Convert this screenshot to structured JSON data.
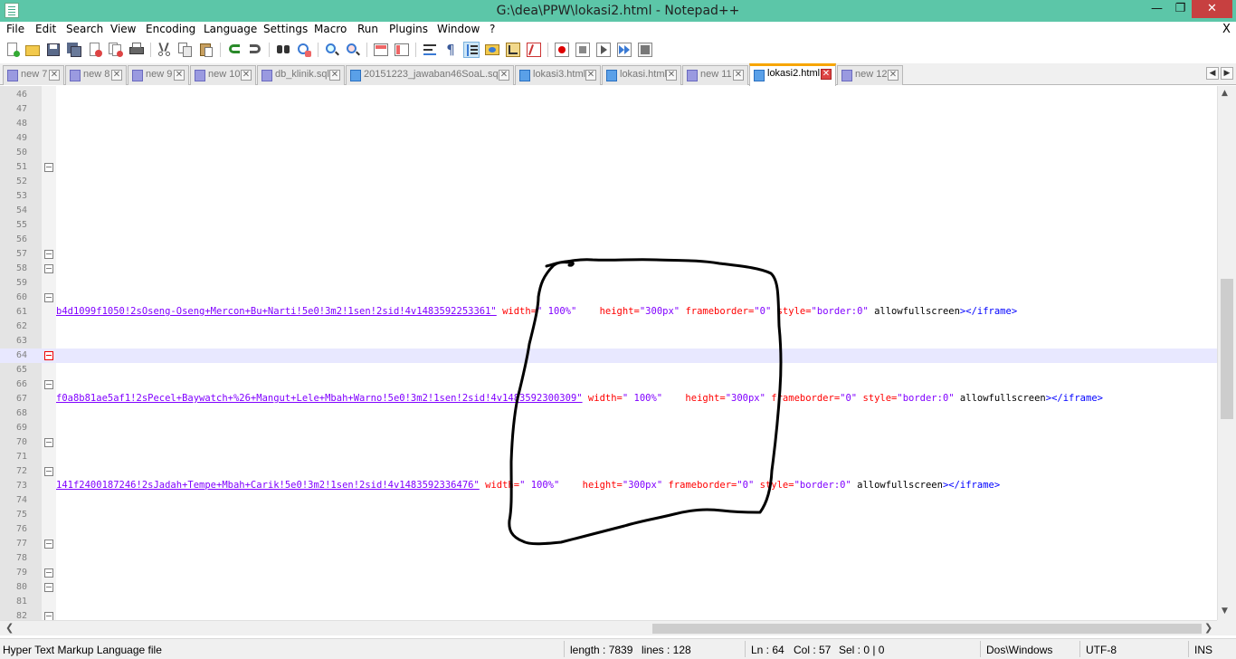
{
  "window": {
    "title": "G:\\dea\\PPW\\lokasi2.html - Notepad++",
    "min_label": "—",
    "max_label": "❐",
    "close_label": "✕"
  },
  "menu": {
    "items": [
      "File",
      "Edit",
      "Search",
      "View",
      "Encoding",
      "Language",
      "Settings",
      "Macro",
      "Run",
      "Plugins",
      "Window",
      "?"
    ],
    "close_doc": "X"
  },
  "toolbar": {
    "icons": [
      "new-file-icon",
      "open-file-icon",
      "save-icon",
      "save-all-icon",
      "close-icon",
      "close-all-icon",
      "print-icon",
      "cut-icon",
      "copy-icon",
      "paste-icon",
      "undo-icon",
      "redo-icon",
      "find-icon",
      "replace-icon",
      "zoom-in-icon",
      "zoom-out-icon",
      "sync-vertical-icon",
      "sync-horizontal-icon",
      "word-wrap-icon",
      "show-all-chars-icon",
      "indent-guide-icon",
      "user-language-icon",
      "doc-map-icon",
      "function-list-icon",
      "record-macro-icon",
      "stop-macro-icon",
      "play-macro-icon",
      "run-macro-multiple-icon",
      "save-macro-icon"
    ]
  },
  "tabs": [
    {
      "label": "new 7",
      "type": "text",
      "active": false
    },
    {
      "label": "new 8",
      "type": "text",
      "active": false
    },
    {
      "label": "new 9",
      "type": "text",
      "active": false
    },
    {
      "label": "new 10",
      "type": "text",
      "active": false
    },
    {
      "label": "db_klinik.sql",
      "type": "text",
      "active": false
    },
    {
      "label": "20151223_jawaban46SoaL.sql",
      "type": "html",
      "active": false
    },
    {
      "label": "lokasi3.html",
      "type": "html",
      "active": false
    },
    {
      "label": "lokasi.html",
      "type": "html",
      "active": false
    },
    {
      "label": "new 11",
      "type": "text",
      "active": false
    },
    {
      "label": "lokasi2.html",
      "type": "html",
      "active": true
    },
    {
      "label": "new 12",
      "type": "text",
      "active": false
    }
  ],
  "tab_close_label": "✕",
  "tab_nav": {
    "prev": "◀",
    "next": "▶"
  },
  "editor": {
    "current_line": 64,
    "lines": [
      {
        "n": "46"
      },
      {
        "n": "47"
      },
      {
        "n": "48"
      },
      {
        "n": "49"
      },
      {
        "n": "50"
      },
      {
        "n": "51",
        "fold": true
      },
      {
        "n": "52"
      },
      {
        "n": "53"
      },
      {
        "n": "54"
      },
      {
        "n": "55"
      },
      {
        "n": "56"
      },
      {
        "n": "57",
        "fold": true
      },
      {
        "n": "58",
        "fold": true
      },
      {
        "n": "59"
      },
      {
        "n": "60",
        "fold": true
      },
      {
        "n": "61",
        "code": {
          "link": "b4d1099f1050!2sOseng-Oseng+Mercon+Bu+Narti!5e0!3m2!1sen!2sid!4v1483592253361\"",
          "w_attr": "width=",
          "w_val": "\" 100%\"",
          "h_attr": "height=",
          "h_val": "\"300px\"",
          "f_attr": "frameborder=",
          "f_val": "\"0\"",
          "s_attr": "style=",
          "s_val": "\"border:0\"",
          "plain": "allowfullscreen",
          "tag": "></iframe>"
        }
      },
      {
        "n": "62"
      },
      {
        "n": "63"
      },
      {
        "n": "64",
        "fold": true,
        "fold_red": true
      },
      {
        "n": "65"
      },
      {
        "n": "66",
        "fold": true
      },
      {
        "n": "67",
        "code": {
          "link": "f0a8b81ae5af1!2sPecel+Baywatch+%26+Mangut+Lele+Mbah+Warno!5e0!3m2!1sen!2sid!4v1483592300309\"",
          "w_attr": "width=",
          "w_val": "\" 100%\"",
          "h_attr": "height=",
          "h_val": "\"300px\"",
          "f_attr": "frameborder=",
          "f_val": "\"0\"",
          "s_attr": "style=",
          "s_val": "\"border:0\"",
          "plain": "allowfullscreen",
          "tag": "></iframe>"
        }
      },
      {
        "n": "68"
      },
      {
        "n": "69"
      },
      {
        "n": "70",
        "fold": true
      },
      {
        "n": "71"
      },
      {
        "n": "72",
        "fold": true
      },
      {
        "n": "73",
        "code": {
          "link": "141f2400187246!2sJadah+Tempe+Mbah+Carik!5e0!3m2!1sen!2sid!4v1483592336476\"",
          "w_attr": "width=",
          "w_val": "\" 100%\"",
          "h_attr": "height=",
          "h_val": "\"300px\"",
          "f_attr": "frameborder=",
          "f_val": "\"0\"",
          "s_attr": "style=",
          "s_val": "\"border:0\"",
          "plain": "allowfullscreen",
          "tag": "></iframe>"
        }
      },
      {
        "n": "74"
      },
      {
        "n": "75"
      },
      {
        "n": "76"
      },
      {
        "n": "77",
        "fold": true
      },
      {
        "n": "78"
      },
      {
        "n": "79",
        "fold": true
      },
      {
        "n": "80",
        "fold": true
      },
      {
        "n": "81"
      },
      {
        "n": "82",
        "fold": true
      }
    ]
  },
  "scroll_arrows": {
    "up": "▲",
    "down": "▼",
    "left": "❮",
    "right": "❯"
  },
  "statusbar": {
    "file_type": "Hyper Text Markup Language file",
    "length": "length : 7839",
    "lines": "lines : 128",
    "ln": "Ln : 64",
    "col": "Col : 57",
    "sel": "Sel : 0 | 0",
    "eol": "Dos\\Windows",
    "encoding": "UTF-8",
    "mode": "INS"
  },
  "colors": {
    "titlebar": "#5cc6a8",
    "link": "#8000ff",
    "attr": "#ff0000",
    "tag": "#0000ff",
    "current_line": "#e8e8ff",
    "active_tab_accent": "#f7a500"
  }
}
